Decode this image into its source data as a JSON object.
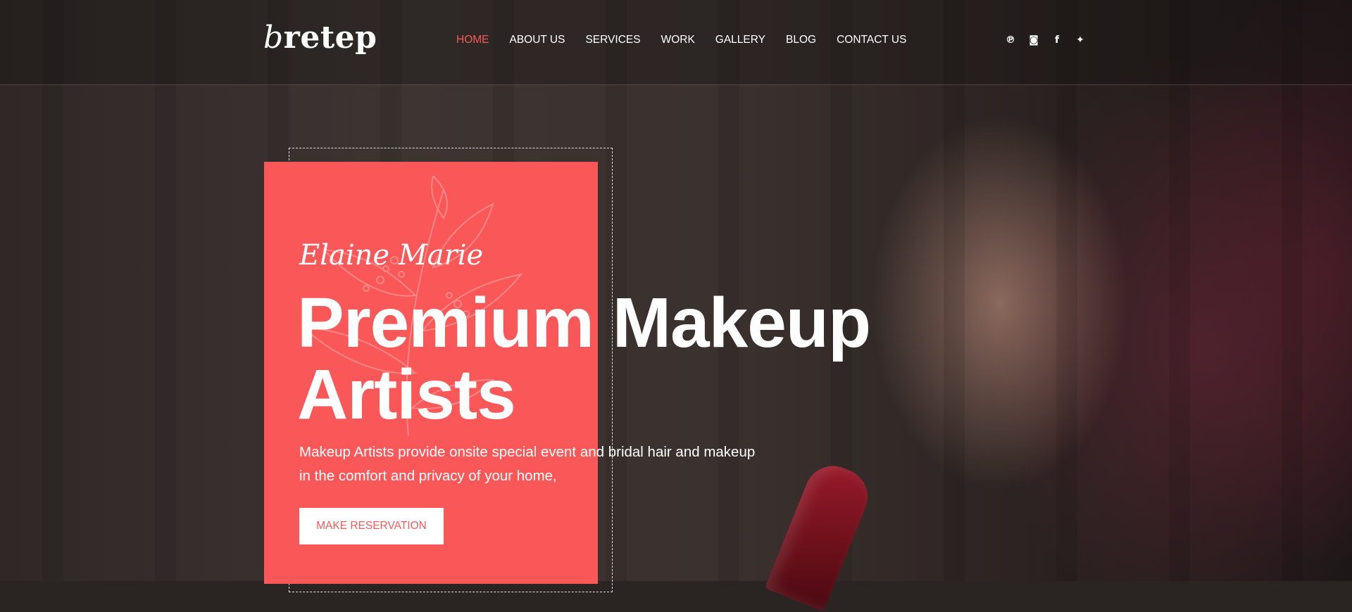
{
  "brand": {
    "logo_first": "b",
    "logo_rest": "retep"
  },
  "nav": {
    "items": [
      {
        "label": "HOME",
        "active": true
      },
      {
        "label": "ABOUT US"
      },
      {
        "label": "SERVICES"
      },
      {
        "label": "WORK"
      },
      {
        "label": "GALLERY"
      },
      {
        "label": "BLOG"
      },
      {
        "label": "CONTACT US"
      }
    ]
  },
  "social": {
    "icons": [
      "pinterest-icon",
      "instagram-icon",
      "facebook-icon",
      "twitter-icon"
    ],
    "glyphs": [
      "℗",
      "◙",
      "f",
      "✦"
    ]
  },
  "hero": {
    "script_name": "Elaine Marie",
    "headline_line1": "Premium Makeup",
    "headline_line2": "Artists",
    "subtext_line1": "Makeup Artists provide onsite special event and bridal hair and makeup",
    "subtext_line2": "in the comfort and privacy of your home,",
    "cta_label": "MAKE RESERVATION"
  },
  "colors": {
    "accent": "#fa5858",
    "text": "#ffffff"
  }
}
